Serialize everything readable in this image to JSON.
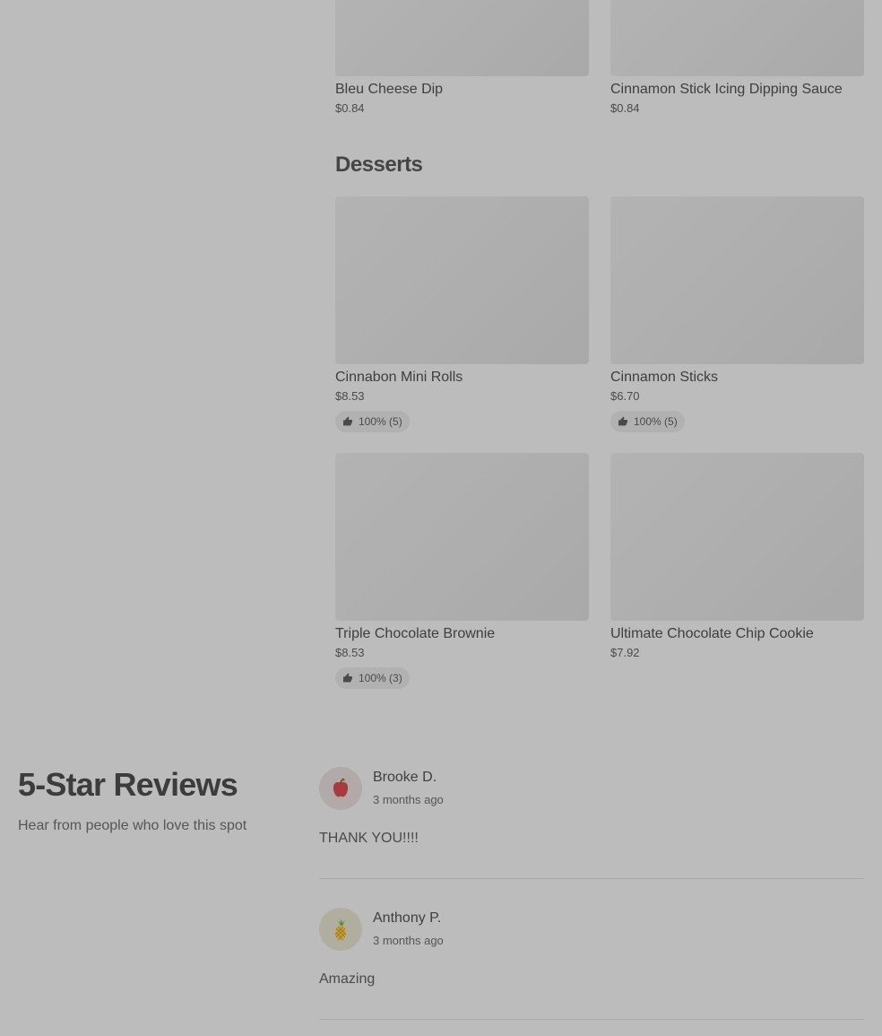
{
  "top_items": [
    {
      "name": "Bleu Cheese Dip",
      "price": "$0.84"
    },
    {
      "name": "Cinnamon Stick Icing Dipping Sauce",
      "price": "$0.84"
    }
  ],
  "desserts": {
    "title": "Desserts",
    "items": [
      {
        "name": "Cinnabon Mini Rolls",
        "price": "$8.53",
        "rating": "100% (5)"
      },
      {
        "name": "Cinnamon Sticks",
        "price": "$6.70",
        "rating": "100% (5)"
      },
      {
        "name": "Triple Chocolate Brownie",
        "price": "$8.53",
        "rating": "100% (3)"
      },
      {
        "name": "Ultimate Chocolate Chip Cookie",
        "price": "$7.92"
      }
    ]
  },
  "reviews": {
    "title": "5-Star Reviews",
    "subtitle": "Hear from people who love this spot",
    "items": [
      {
        "author": "Brooke D.",
        "when": "3 months ago",
        "text": "THANK YOU!!!!",
        "avatar_icon": "apple-icon"
      },
      {
        "author": "Anthony P.",
        "when": "3 months ago",
        "text": "Amazing",
        "avatar_icon": "pineapple-icon"
      }
    ]
  },
  "colors": {
    "overlay_background": "#bcbcbc",
    "image_placeholder": "#aeaeae",
    "rating_pill": "#b1b1b1"
  }
}
